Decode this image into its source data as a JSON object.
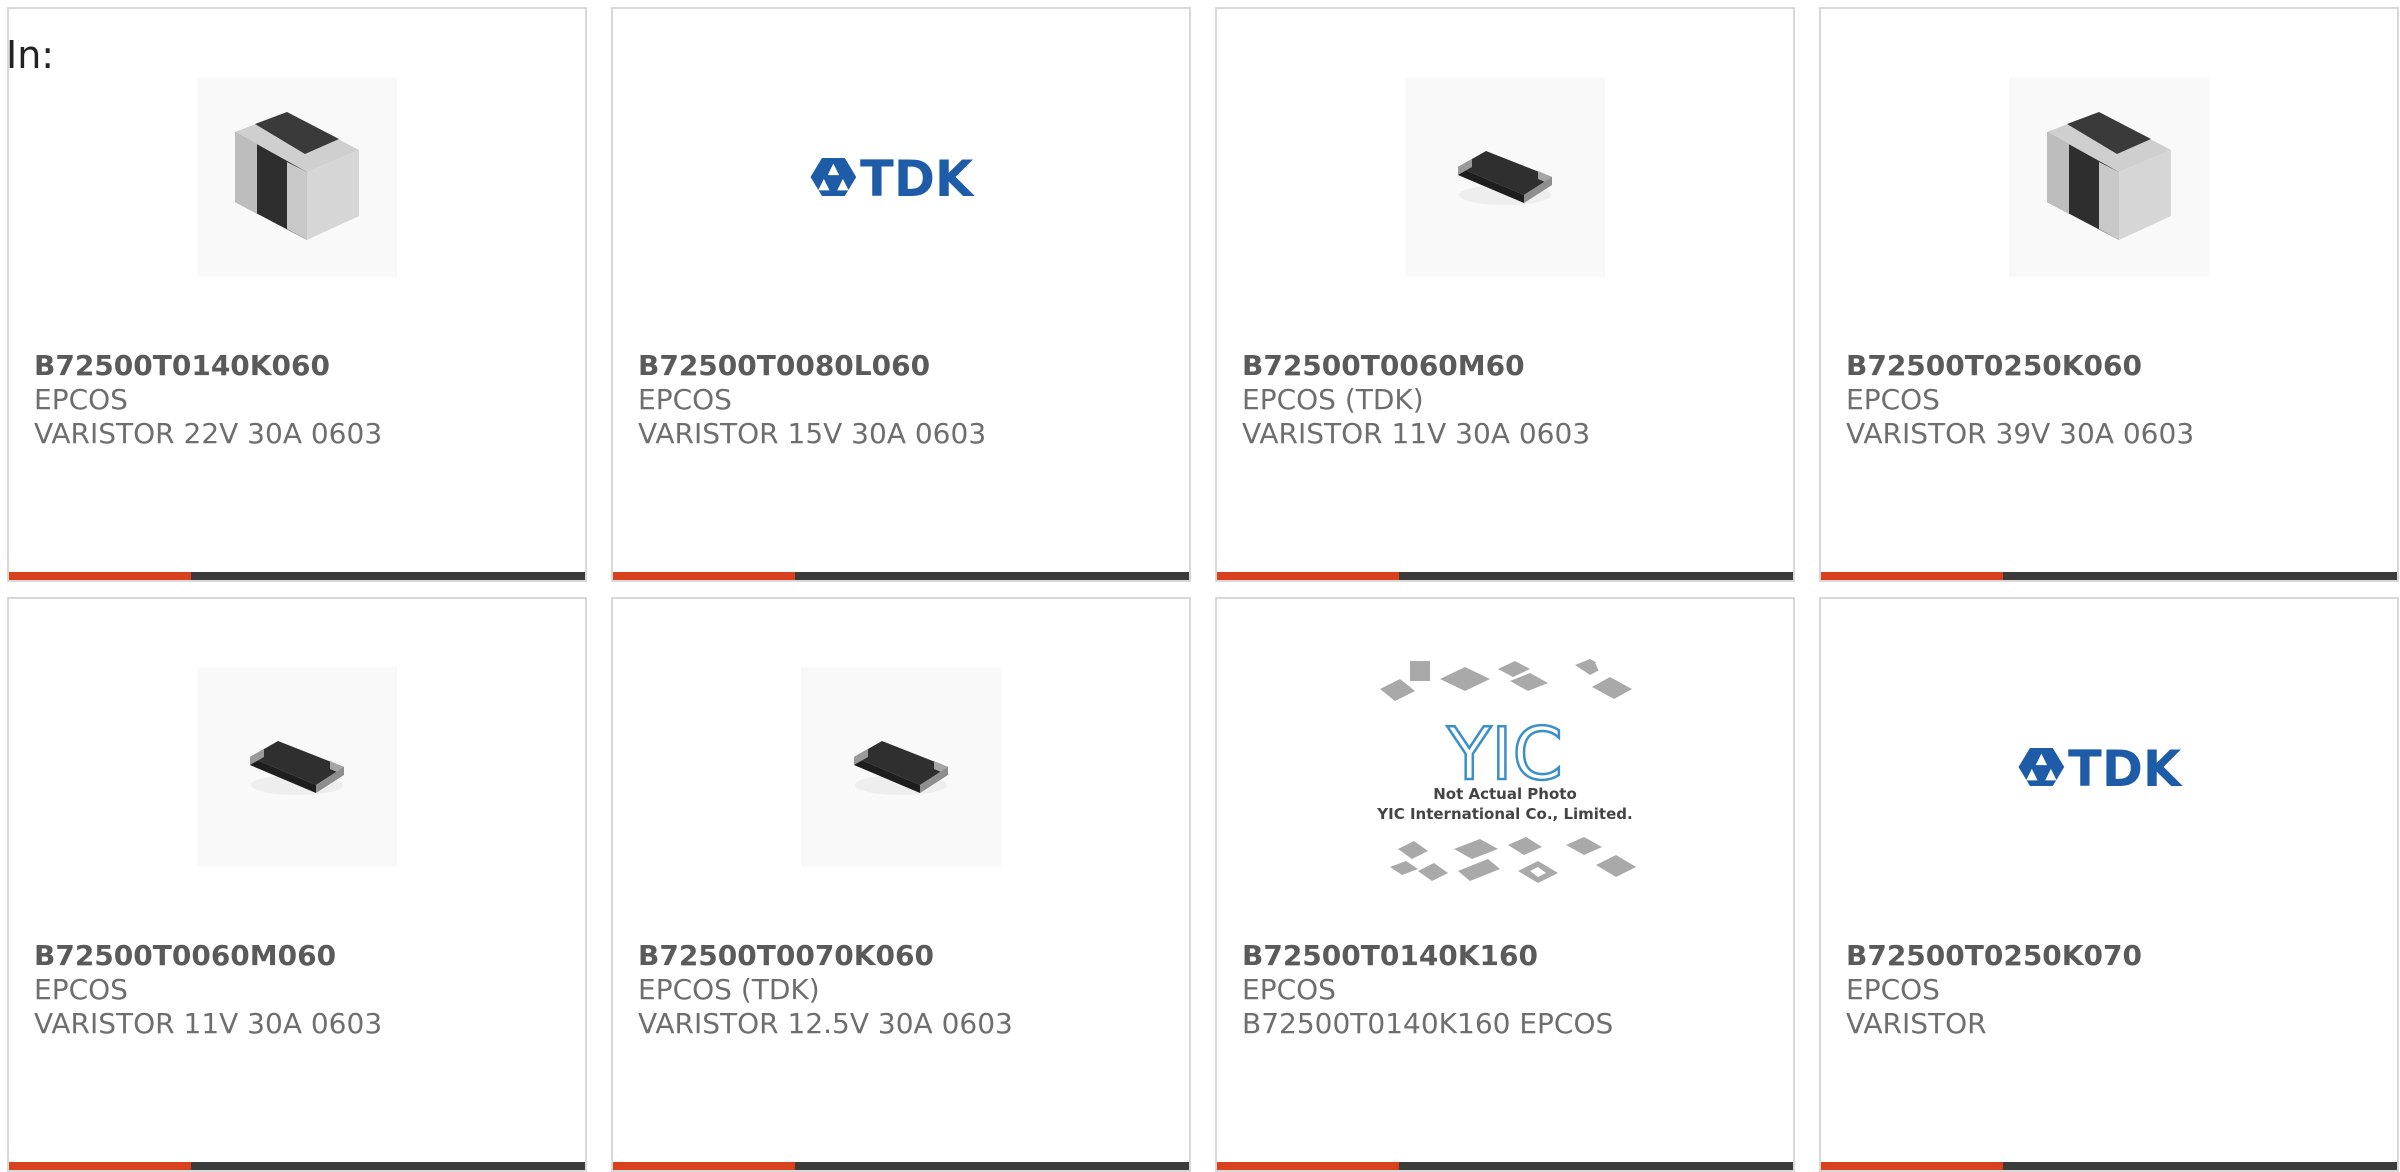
{
  "filter_label": "In:",
  "products": [
    {
      "part": "B72500T0140K060",
      "brand": "EPCOS",
      "desc": "VARISTOR 22V 30A 0603",
      "image": "large-chip-image"
    },
    {
      "part": "B72500T0080L060",
      "brand": "EPCOS",
      "desc": "VARISTOR 15V 30A 0603",
      "image": "tdk-logo-image"
    },
    {
      "part": "B72500T0060M60",
      "brand": "EPCOS (TDK)",
      "desc": "VARISTOR 11V 30A 0603",
      "image": "small-chip-image"
    },
    {
      "part": "B72500T0250K060",
      "brand": "EPCOS",
      "desc": "VARISTOR 39V 30A 0603",
      "image": "large-chip-image"
    },
    {
      "part": "B72500T0060M060",
      "brand": "EPCOS",
      "desc": "VARISTOR 11V 30A 0603",
      "image": "small-chip-image"
    },
    {
      "part": "B72500T0070K060",
      "brand": "EPCOS (TDK)",
      "desc": "VARISTOR 12.5V 30A 0603",
      "image": "small-chip-image"
    },
    {
      "part": "B72500T0140K160",
      "brand": "EPCOS",
      "desc": "B72500T0140K160 EPCOS",
      "image": "yic-placeholder-image"
    },
    {
      "part": "B72500T0250K070",
      "brand": "EPCOS",
      "desc": "VARISTOR",
      "image": "tdk-logo-image"
    }
  ],
  "tdk_logo_text": "TDK",
  "yic_placeholder": {
    "line1": "Not Actual Photo",
    "line2": "YIC International Co., Limited.",
    "mark": "YIC"
  },
  "colors": {
    "accent": "#d9401e",
    "bar": "#3b3b3b",
    "border": "#d8d8d8",
    "tdk_blue": "#1f5ca8"
  }
}
